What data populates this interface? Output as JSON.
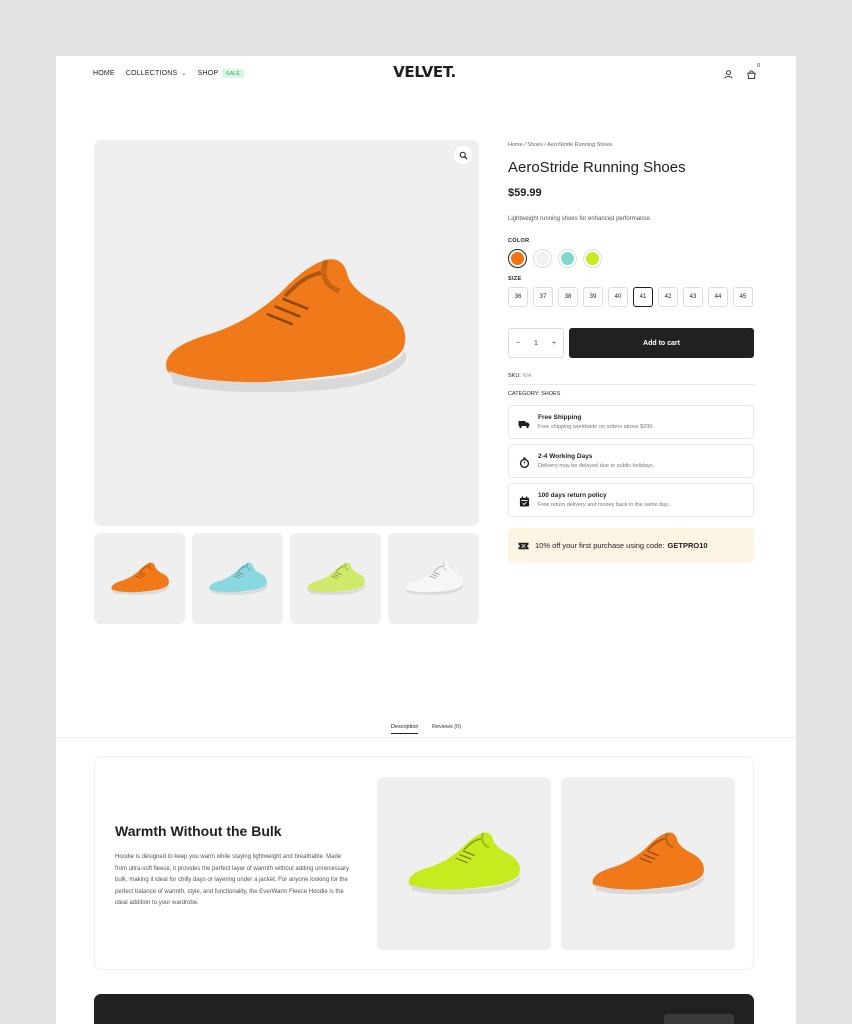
{
  "header": {
    "nav": [
      {
        "label": "HOME"
      },
      {
        "label": "COLLECTIONS"
      },
      {
        "label": "SHOP",
        "badge": "SALE"
      }
    ],
    "logo": "VELVET.",
    "cart_count": "0"
  },
  "product": {
    "breadcrumb": "Home / Shoes / AeroStride Running Shoes",
    "title": "AeroStride Running Shoes",
    "price": "$59.99",
    "short_desc": "Lightweight running shoes for enhanced performance.",
    "color_label": "COLOR",
    "colors": [
      "#f2730f",
      "#f1f1f1",
      "#7fd8cc",
      "#c7ec20"
    ],
    "selected_color_index": 0,
    "size_label": "SIZE",
    "sizes": [
      "36",
      "37",
      "38",
      "39",
      "40",
      "41",
      "42",
      "43",
      "44",
      "45"
    ],
    "selected_size": "41",
    "quantity": "1",
    "qty_minus": "−",
    "qty_plus": "+",
    "add_to_cart": "Add to cart",
    "sku_label": "SKU:",
    "sku_value": "N/A",
    "category_label": "CATEGORY:",
    "category_value": "SHOES"
  },
  "features": [
    {
      "icon": "truck-icon",
      "title": "Free Shipping",
      "text": "Free shipping worldwide on orders above $200."
    },
    {
      "icon": "stopwatch-icon",
      "title": "2-4 Working Days",
      "text": "Delivery may be delayed due to public holidays."
    },
    {
      "icon": "calendar-icon",
      "title": "100 days return policy",
      "text": "Free return delivery and money back in the same day."
    }
  ],
  "promo": {
    "text": "10% off your first purchase using code:",
    "code": "GETPRO10",
    "icon": "ticket-icon"
  },
  "tabs": [
    {
      "label": "Description"
    },
    {
      "label": "Reviews (0)"
    }
  ],
  "description": {
    "title": "Warmth Without the Bulk",
    "body": "Hoodie is designed to keep you warm while staying lightweight and breathable. Made from ultra-soft fleece, it provides the perfect layer of warmth without adding unnecessary bulk, making it ideal for chilly days or layering under a jacket. For anyone looking for the perfect balance of warmth, style, and functionality, the EverWarm Fleece Hoodie is the ideal addition to your wardrobe."
  },
  "colors": {
    "accent": "#202123",
    "promo_bg": "#fcf4e3",
    "sale_badge": "#2aa35a"
  }
}
